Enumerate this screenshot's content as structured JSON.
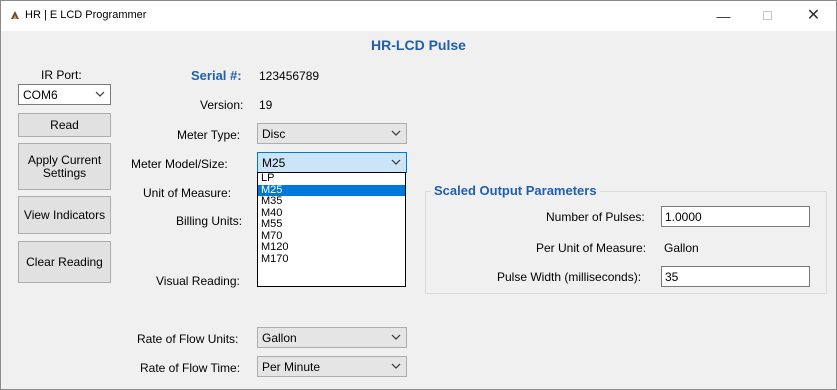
{
  "window": {
    "title": "HR | E LCD Programmer",
    "min_glyph": "—",
    "max_glyph": "☐",
    "close_glyph": "✕",
    "app_icon": "hr-e-logo-icon"
  },
  "heading": "HR-LCD Pulse",
  "left_panel": {
    "ir_port_label": "IR Port:",
    "ir_port_value": "COM6",
    "read_button": "Read",
    "apply_button": "Apply Current Settings",
    "view_button": "View Indicators",
    "clear_button": "Clear Reading"
  },
  "form": {
    "serial_label": "Serial #:",
    "serial_value": "123456789",
    "version_label": "Version:",
    "version_value": "19",
    "meter_type_label": "Meter Type:",
    "meter_type_value": "Disc",
    "meter_model_label": "Meter Model/Size:",
    "meter_model_value": "M25",
    "unit_of_measure_label": "Unit of Measure:",
    "billing_units_label": "Billing Units:",
    "visual_reading_label": "Visual Reading:",
    "rate_flow_units_label": "Rate of Flow Units:",
    "rate_flow_units_value": "Gallon",
    "rate_flow_time_label": "Rate of Flow Time:",
    "rate_flow_time_value": "Per Minute"
  },
  "meter_model_options": [
    "LP",
    "M25",
    "M35",
    "M40",
    "M55",
    "M70",
    "M120",
    "M170"
  ],
  "meter_model_selected": "M25",
  "scaled_output": {
    "title": "Scaled Output Parameters",
    "num_pulses_label": "Number of Pulses:",
    "num_pulses_value": "1.0000",
    "per_unit_label": "Per Unit of Measure:",
    "per_unit_value": "Gallon",
    "pulse_width_label": "Pulse Width (milliseconds):",
    "pulse_width_value": "35"
  },
  "colors": {
    "accent": "#1f5fae",
    "selection": "#0078d7",
    "window_bg": "#f0f0f0"
  }
}
